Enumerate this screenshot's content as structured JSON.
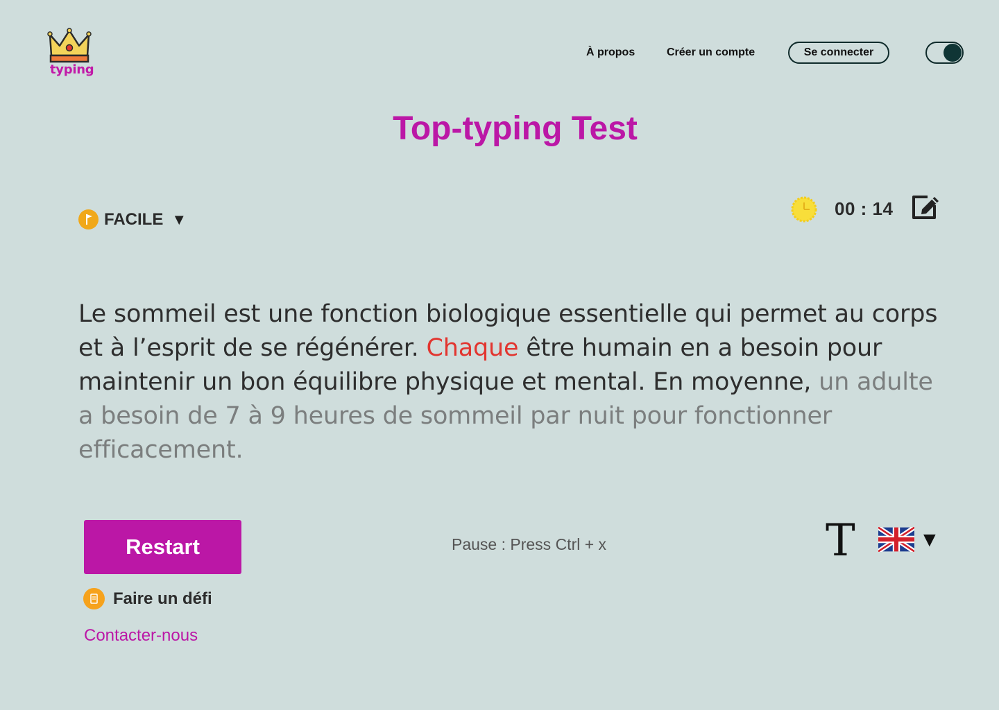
{
  "header": {
    "logo_text": "typing",
    "nav": {
      "about": "À propos",
      "create_account": "Créer un compte",
      "login": "Se connecter"
    }
  },
  "title": "Top-typing Test",
  "difficulty": {
    "label": "FACILE",
    "caret": "▼"
  },
  "timer": {
    "value": "00 : 14"
  },
  "passage": {
    "typed": "Le sommeil est une fonction biologique essentielle qui permet au corps et à l’esprit de se régénérer. ",
    "current": "Chaque",
    "typed_after": " être humain en a besoin pour maintenir un bon équilibre physique et mental. En moyenne, ",
    "remaining": "un adulte a besoin de 7 à 9 heures de sommeil par nuit pour fonctionner efficacement."
  },
  "actions": {
    "restart": "Restart",
    "pause_hint": "Pause : Press Ctrl + x",
    "challenge": "Faire un défi",
    "contact": "Contacter-nous"
  },
  "settings": {
    "font_glyph": "T",
    "language_caret": "▼",
    "language_icon": "uk-flag-icon"
  },
  "colors": {
    "accent": "#bb17a6",
    "background": "#cfdddc",
    "current_word": "#e2352f",
    "remaining_text": "#7b7e7e"
  }
}
